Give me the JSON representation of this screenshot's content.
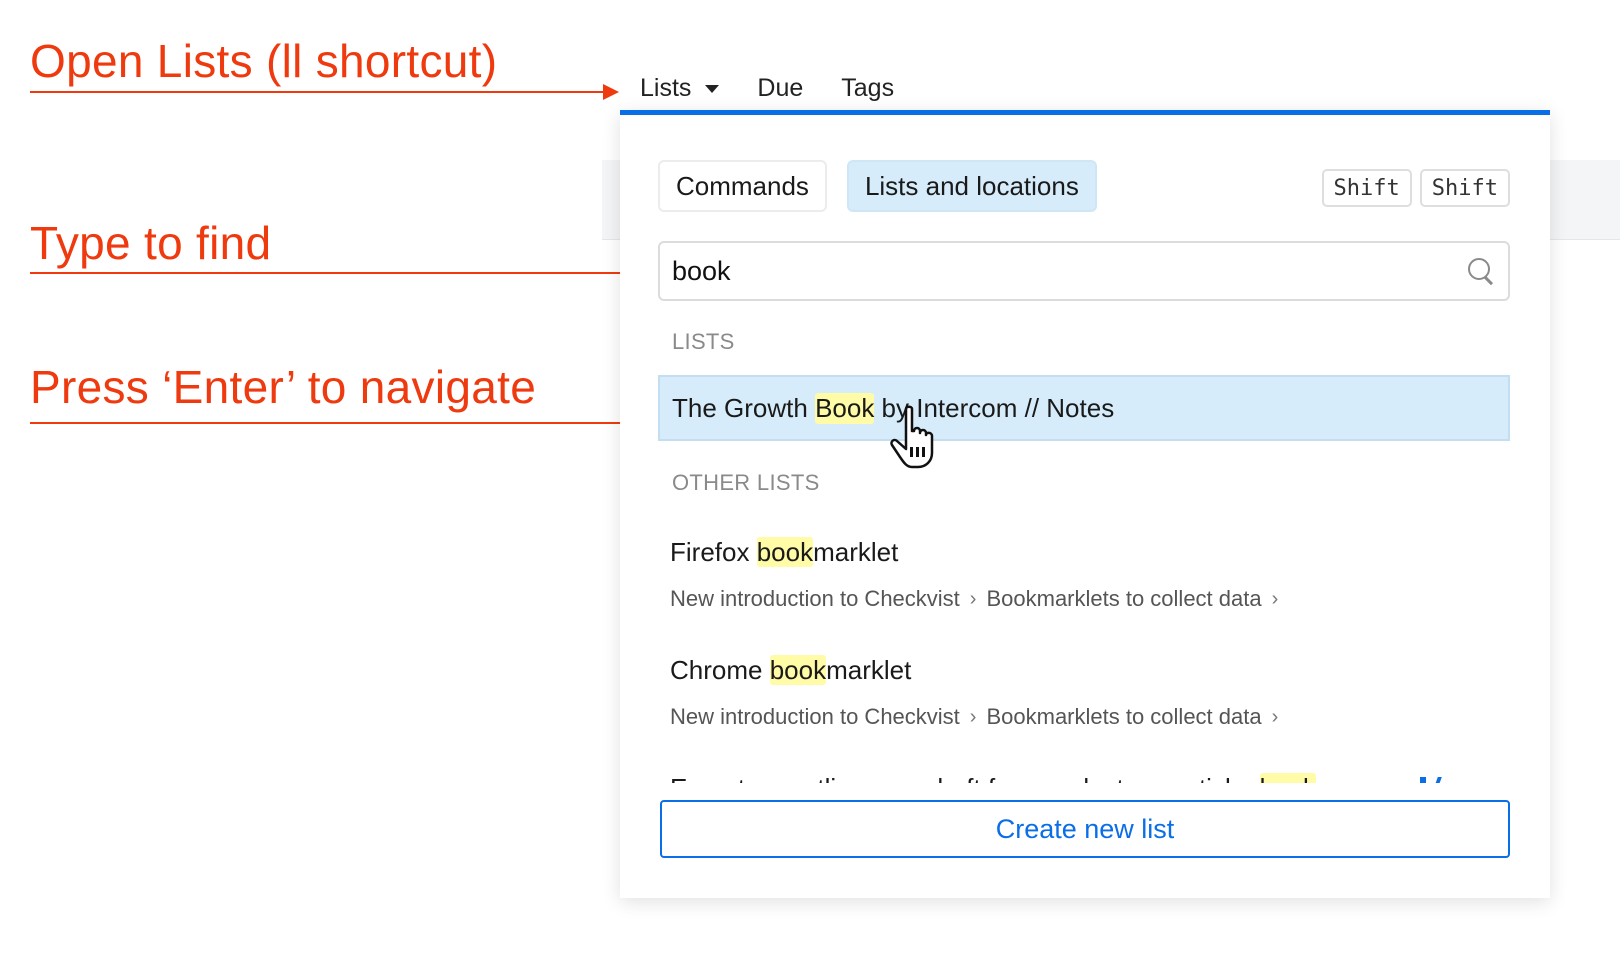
{
  "annotations": [
    {
      "text": "Open Lists (ll shortcut)"
    },
    {
      "text": "Type to find"
    },
    {
      "text": "Press ‘Enter’ to navigate"
    }
  ],
  "topnav": {
    "items": [
      {
        "label": "Lists",
        "has_dropdown": true
      },
      {
        "label": "Due"
      },
      {
        "label": "Tags"
      }
    ]
  },
  "popup": {
    "tabs": [
      {
        "label": "Commands",
        "active": false
      },
      {
        "label": "Lists and locations",
        "active": true
      }
    ],
    "shortcut_keys": [
      "Shift",
      "Shift"
    ],
    "search": {
      "value": "book",
      "icon": "search-icon"
    },
    "sections": {
      "lists": {
        "label": "LISTS",
        "items": [
          {
            "before": "The Growth ",
            "match": "Book",
            "after": " by Intercom // Notes",
            "selected": true
          }
        ]
      },
      "other_lists": {
        "label": "OTHER LISTS",
        "items": [
          {
            "before": "Firefox ",
            "match": "book",
            "after": "marklet",
            "path": [
              "New introduction to Checkvist",
              "Bookmarklets to collect data"
            ]
          },
          {
            "before": "Chrome ",
            "match": "book",
            "after": "marklet",
            "path": [
              "New introduction to Checkvist",
              "Bookmarklets to collect data"
            ]
          },
          {
            "before": "Export an outline as a draft for your lecture, article, ",
            "match": "book",
            "after": " or ...",
            "clipped": true
          }
        ]
      }
    },
    "create_button": "Create new list"
  },
  "colors": {
    "accent": "#0a6ee6",
    "annotation": "#ee3a0e",
    "highlight": "#fffba6",
    "selected_bg": "#d6ecfb"
  }
}
